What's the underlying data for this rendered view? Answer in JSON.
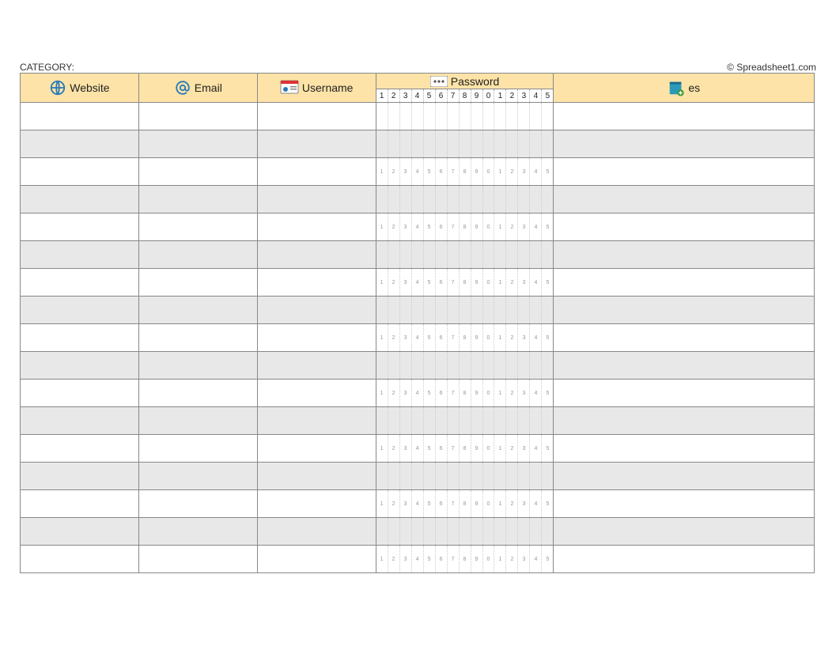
{
  "topbar": {
    "category_label": "CATEGORY:",
    "copyright": "© Spreadsheet1.com"
  },
  "headers": {
    "website": "Website",
    "email": "Email",
    "username": "Username",
    "password": "Password",
    "notes": "es"
  },
  "password_digits": [
    "1",
    "2",
    "3",
    "4",
    "5",
    "6",
    "7",
    "8",
    "9",
    "0",
    "1",
    "2",
    "3",
    "4",
    "5"
  ],
  "tiny_digits": [
    "1",
    "2",
    "3",
    "4",
    "5",
    "6",
    "7",
    "8",
    "9",
    "0",
    "1",
    "2",
    "3",
    "4",
    "5"
  ],
  "rows": [
    {
      "website": "",
      "email": "",
      "username": "",
      "notes": "",
      "show_tiny": false,
      "alt": false
    },
    {
      "website": "",
      "email": "",
      "username": "",
      "notes": "",
      "show_tiny": false,
      "alt": true
    },
    {
      "website": "",
      "email": "",
      "username": "",
      "notes": "",
      "show_tiny": true,
      "alt": false
    },
    {
      "website": "",
      "email": "",
      "username": "",
      "notes": "",
      "show_tiny": false,
      "alt": true
    },
    {
      "website": "",
      "email": "",
      "username": "",
      "notes": "",
      "show_tiny": true,
      "alt": false
    },
    {
      "website": "",
      "email": "",
      "username": "",
      "notes": "",
      "show_tiny": false,
      "alt": true
    },
    {
      "website": "",
      "email": "",
      "username": "",
      "notes": "",
      "show_tiny": true,
      "alt": false
    },
    {
      "website": "",
      "email": "",
      "username": "",
      "notes": "",
      "show_tiny": false,
      "alt": true
    },
    {
      "website": "",
      "email": "",
      "username": "",
      "notes": "",
      "show_tiny": true,
      "alt": false
    },
    {
      "website": "",
      "email": "",
      "username": "",
      "notes": "",
      "show_tiny": false,
      "alt": true
    },
    {
      "website": "",
      "email": "",
      "username": "",
      "notes": "",
      "show_tiny": true,
      "alt": false
    },
    {
      "website": "",
      "email": "",
      "username": "",
      "notes": "",
      "show_tiny": false,
      "alt": true
    },
    {
      "website": "",
      "email": "",
      "username": "",
      "notes": "",
      "show_tiny": true,
      "alt": false
    },
    {
      "website": "",
      "email": "",
      "username": "",
      "notes": "",
      "show_tiny": false,
      "alt": true
    },
    {
      "website": "",
      "email": "",
      "username": "",
      "notes": "",
      "show_tiny": true,
      "alt": false
    },
    {
      "website": "",
      "email": "",
      "username": "",
      "notes": "",
      "show_tiny": false,
      "alt": true
    },
    {
      "website": "",
      "email": "",
      "username": "",
      "notes": "",
      "show_tiny": true,
      "alt": false
    }
  ]
}
